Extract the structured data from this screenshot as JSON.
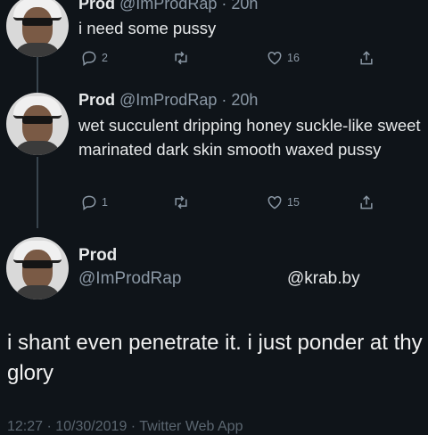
{
  "tweets": [
    {
      "name": "Prod",
      "handle": "@ImProdRap",
      "time": "· 20h",
      "text": "i need some pussy",
      "replies": "2",
      "likes": "16"
    },
    {
      "name": "Prod",
      "handle": "@ImProdRap",
      "time": "· 20h",
      "text": "wet succulent dripping honey suckle-like sweet marinated dark skin smooth waxed pussy",
      "replies": "1",
      "likes": "15"
    }
  ],
  "main": {
    "name": "Prod",
    "handle": "@ImProdRap",
    "watermark": "@krab.by",
    "text": "i shant even penetrate it. i just ponder at thy glory",
    "meta": "12:27 · 10/30/2019 · Twitter Web App"
  },
  "icons": [
    "reply-icon",
    "retweet-icon",
    "like-icon",
    "share-icon"
  ],
  "colors": {
    "background": "#0f1419",
    "muted": "#8b98a5",
    "text": "#e7e9ea"
  }
}
